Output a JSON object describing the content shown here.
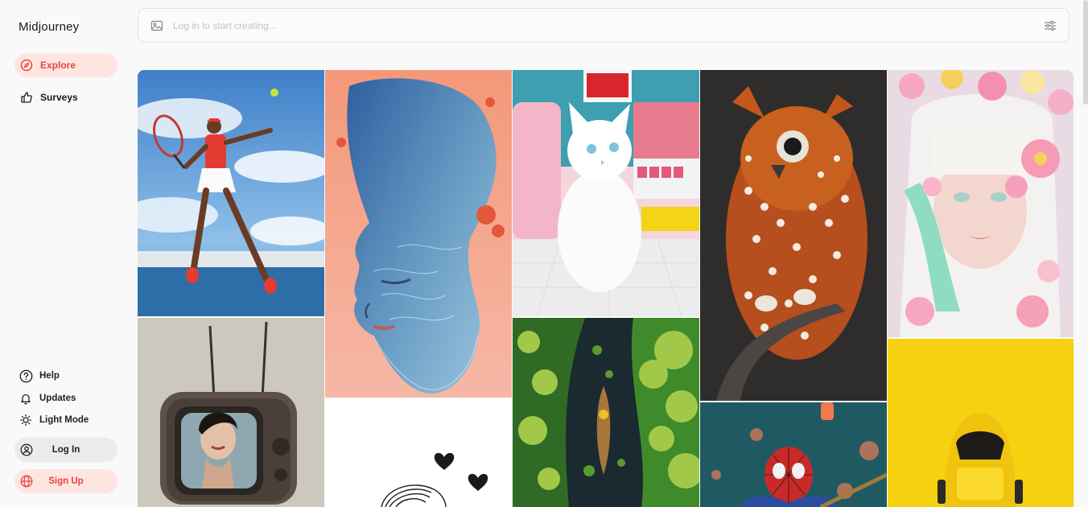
{
  "app": {
    "title": "Midjourney"
  },
  "sidebar": {
    "nav": [
      {
        "label": "Explore",
        "icon": "compass-icon",
        "active": true
      },
      {
        "label": "Surveys",
        "icon": "thumbs-up-icon",
        "active": false
      }
    ],
    "utilities": [
      {
        "label": "Help",
        "icon": "help-icon"
      },
      {
        "label": "Updates",
        "icon": "bell-icon"
      },
      {
        "label": "Light Mode",
        "icon": "sun-icon"
      }
    ],
    "login_label": "Log In",
    "signup_label": "Sign Up"
  },
  "search": {
    "placeholder": "Log in to start creating..."
  },
  "colors": {
    "accent": "#e8453c",
    "accent_bg": "#fde6e2"
  },
  "gallery": {
    "items": [
      {
        "subject": "tennis player"
      },
      {
        "subject": "vintage television"
      },
      {
        "subject": "water portrait"
      },
      {
        "subject": "heart sketch"
      },
      {
        "subject": "white kitten"
      },
      {
        "subject": "canoe aerial"
      },
      {
        "subject": "spotted owl"
      },
      {
        "subject": "spider-man"
      },
      {
        "subject": "flower portrait"
      },
      {
        "subject": "yellow car"
      }
    ]
  }
}
